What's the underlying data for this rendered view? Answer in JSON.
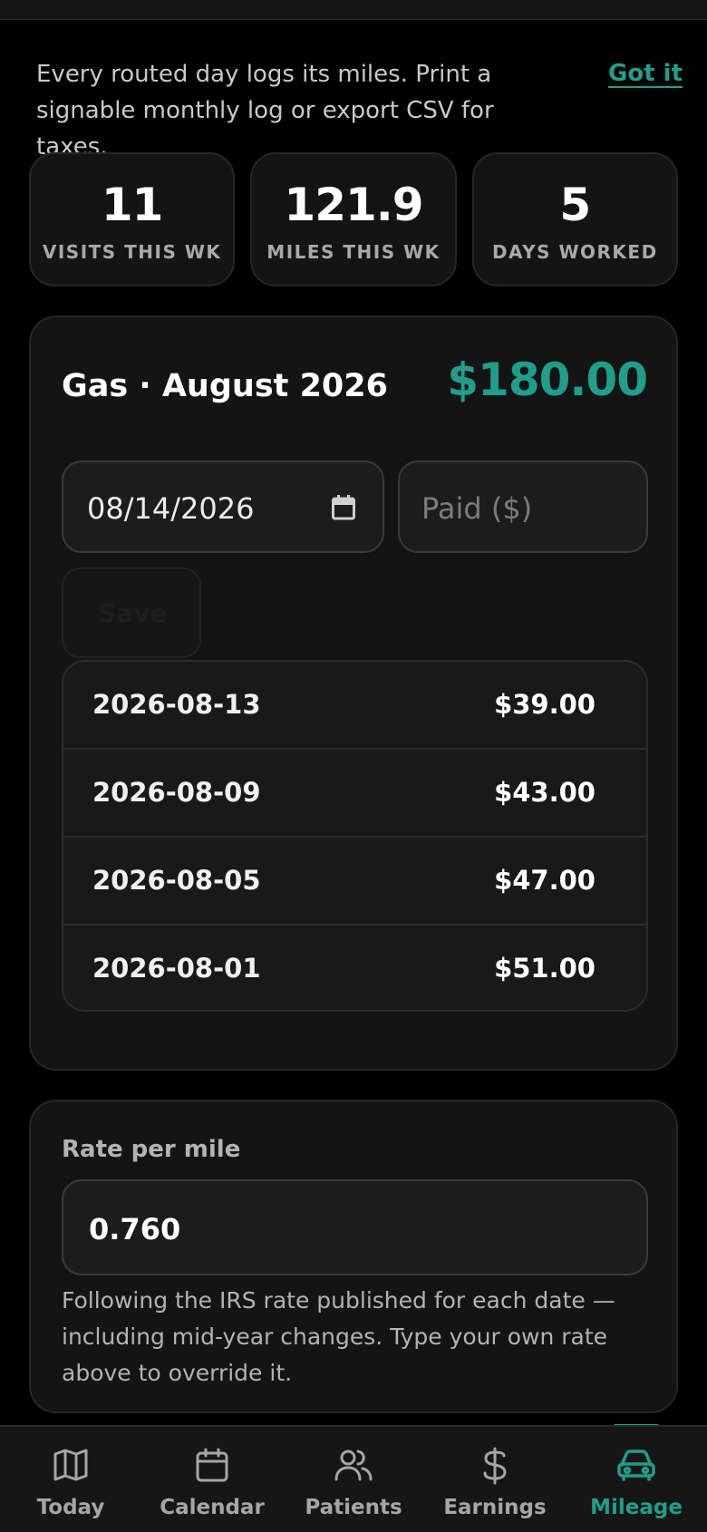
{
  "tip": {
    "text": "Every routed day logs its miles. Print a signable monthly log or export CSV for taxes.",
    "dismiss_label": "Got it"
  },
  "stats": [
    {
      "value": "11",
      "label": "VISITS THIS WK"
    },
    {
      "value": "121.9",
      "label": "MILES THIS WK"
    },
    {
      "value": "5",
      "label": "DAYS WORKED"
    }
  ],
  "gas": {
    "title": "Gas · August 2026",
    "total": "$180.00",
    "date_value": "08/14/2026",
    "paid_placeholder": "Paid ($)",
    "save_label": "Save",
    "entries": [
      {
        "date": "2026-08-13",
        "amount": "$39.00"
      },
      {
        "date": "2026-08-09",
        "amount": "$43.00"
      },
      {
        "date": "2026-08-05",
        "amount": "$47.00"
      },
      {
        "date": "2026-08-01",
        "amount": "$51.00"
      }
    ]
  },
  "rate": {
    "label": "Rate per mile",
    "value": "0.760",
    "note": "Following the IRS rate published for each date — including mid-year changes. Type your own rate above to override it."
  },
  "nav": {
    "items": [
      {
        "label": "Today",
        "icon": "map-icon"
      },
      {
        "label": "Calendar",
        "icon": "calendar-icon"
      },
      {
        "label": "Patients",
        "icon": "users-icon"
      },
      {
        "label": "Earnings",
        "icon": "dollar-icon"
      },
      {
        "label": "Mileage",
        "icon": "car-icon"
      }
    ],
    "active": "Mileage"
  },
  "colors": {
    "accent": "#1f9e8c",
    "background": "#000000",
    "card": "#141414"
  }
}
